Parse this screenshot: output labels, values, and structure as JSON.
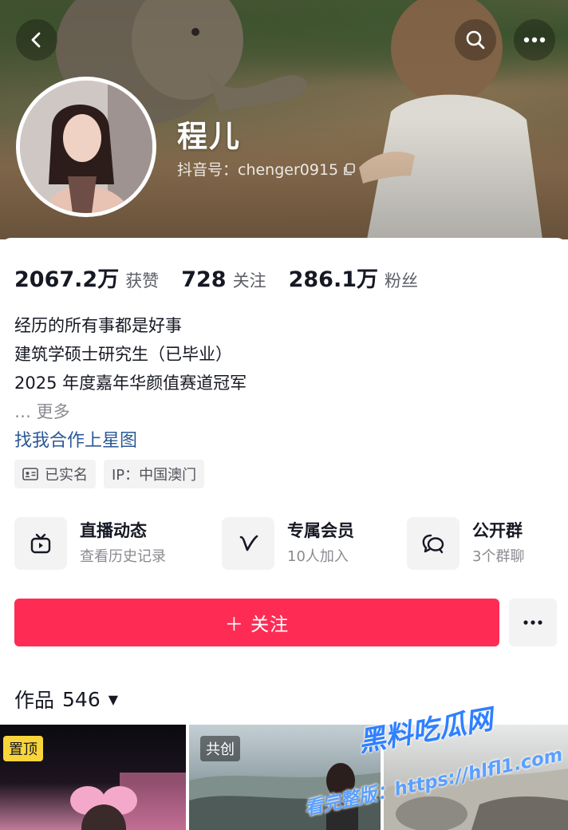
{
  "header": {
    "nickname": "程儿",
    "douyin_id": "抖音号：chenger0915",
    "back_icon": "back-arrow-icon",
    "search_icon": "search-icon",
    "more_icon": "more-dots-icon"
  },
  "stats": [
    {
      "value": "2067.2万",
      "label": "获赞"
    },
    {
      "value": "728",
      "label": "关注"
    },
    {
      "value": "286.1万",
      "label": "粉丝"
    }
  ],
  "bio": {
    "lines": [
      "经历的所有事都是好事",
      "建筑学硕士研究生（已毕业）",
      "2025 年度嘉年华颜值赛道冠军"
    ],
    "more": "… 更多",
    "link": "找我合作上星图"
  },
  "tags": [
    {
      "icon": "id-card-icon",
      "label": "已实名"
    },
    {
      "label": "IP：中国澳门"
    }
  ],
  "features": [
    {
      "icon": "tv-icon",
      "title": "直播动态",
      "subtitle": "查看历史记录"
    },
    {
      "icon": "v-logo-icon",
      "title": "专属会员",
      "subtitle": "10人加入"
    },
    {
      "icon": "chat-bubbles-icon",
      "title": "公开群",
      "subtitle": "3个群聊"
    }
  ],
  "follow_button": "＋ 关注",
  "works": {
    "label": "作品",
    "count": "546",
    "caret": "▼"
  },
  "grid": [
    {
      "badge": "置顶"
    },
    {
      "badge": "共创"
    },
    {
      "badge": ""
    }
  ],
  "watermark": {
    "line1": "黑料吃瓜网",
    "line2": "看完整版：https://hlfl1.com"
  },
  "colors": {
    "accent": "#fe2c55",
    "link": "#2b5896",
    "pinned_badge": "#fad53a"
  }
}
